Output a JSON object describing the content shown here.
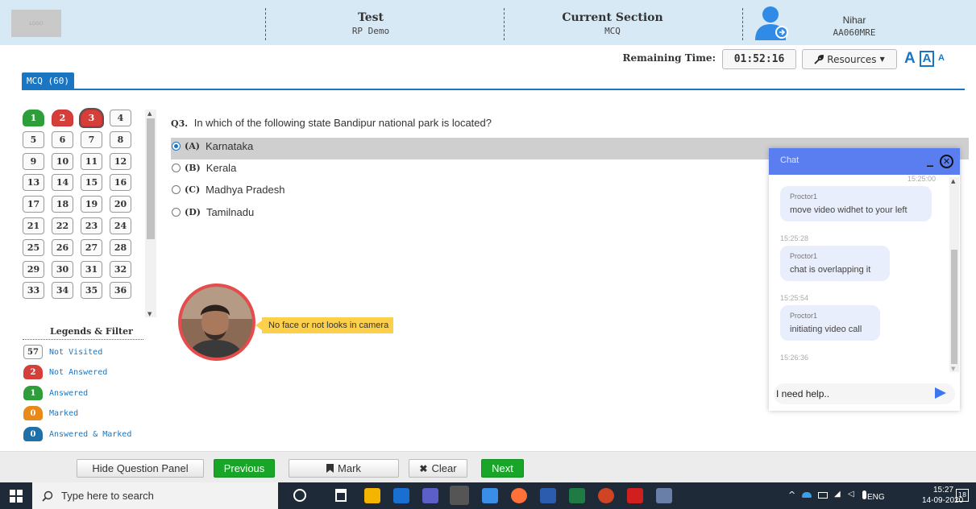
{
  "header": {
    "logo_text": "LOGO",
    "test_title": "Test",
    "test_name": "RP Demo",
    "section_title": "Current Section",
    "section_name": "MCQ",
    "user_name": "Nihar",
    "user_id": "AA060MRE"
  },
  "toolbar": {
    "remaining_label": "Remaining Time:",
    "timer": "01:52:16",
    "resources_label": "Resources",
    "font_large": "A",
    "font_medium": "A",
    "font_small": "A"
  },
  "section_tab": "MCQ (60)",
  "palette": {
    "questions": [
      {
        "n": "1",
        "state": "answered"
      },
      {
        "n": "2",
        "state": "not-answered"
      },
      {
        "n": "3",
        "state": "not-answered-current"
      },
      {
        "n": "4",
        "state": "not-visited"
      },
      {
        "n": "5",
        "state": "not-visited"
      },
      {
        "n": "6",
        "state": "not-visited"
      },
      {
        "n": "7",
        "state": "not-visited"
      },
      {
        "n": "8",
        "state": "not-visited"
      },
      {
        "n": "9",
        "state": "not-visited"
      },
      {
        "n": "10",
        "state": "not-visited"
      },
      {
        "n": "11",
        "state": "not-visited"
      },
      {
        "n": "12",
        "state": "not-visited"
      },
      {
        "n": "13",
        "state": "not-visited"
      },
      {
        "n": "14",
        "state": "not-visited"
      },
      {
        "n": "15",
        "state": "not-visited"
      },
      {
        "n": "16",
        "state": "not-visited"
      },
      {
        "n": "17",
        "state": "not-visited"
      },
      {
        "n": "18",
        "state": "not-visited"
      },
      {
        "n": "19",
        "state": "not-visited"
      },
      {
        "n": "20",
        "state": "not-visited"
      },
      {
        "n": "21",
        "state": "not-visited"
      },
      {
        "n": "22",
        "state": "not-visited"
      },
      {
        "n": "23",
        "state": "not-visited"
      },
      {
        "n": "24",
        "state": "not-visited"
      },
      {
        "n": "25",
        "state": "not-visited"
      },
      {
        "n": "26",
        "state": "not-visited"
      },
      {
        "n": "27",
        "state": "not-visited"
      },
      {
        "n": "28",
        "state": "not-visited"
      },
      {
        "n": "29",
        "state": "not-visited"
      },
      {
        "n": "30",
        "state": "not-visited"
      },
      {
        "n": "31",
        "state": "not-visited"
      },
      {
        "n": "32",
        "state": "not-visited"
      },
      {
        "n": "33",
        "state": "not-visited"
      },
      {
        "n": "34",
        "state": "not-visited"
      },
      {
        "n": "35",
        "state": "not-visited"
      },
      {
        "n": "36",
        "state": "not-visited"
      }
    ]
  },
  "legends": {
    "title": "Legends & Filter",
    "items": [
      {
        "count": "57",
        "label": "Not Visited",
        "color": "#fafafa"
      },
      {
        "count": "2",
        "label": "Not Answered",
        "color": "#d43f3a"
      },
      {
        "count": "1",
        "label": "Answered",
        "color": "#2e9e3a"
      },
      {
        "count": "0",
        "label": "Marked",
        "color": "#e8891a"
      },
      {
        "count": "0",
        "label": "Answered & Marked",
        "color": "#1f6fa8"
      }
    ]
  },
  "question": {
    "number": "Q3.",
    "text": "In which of the following state Bandipur national park is located?",
    "options": [
      {
        "label": "(A)",
        "text": "Karnataka",
        "selected": true
      },
      {
        "label": "(B)",
        "text": "Kerala",
        "selected": false
      },
      {
        "label": "(C)",
        "text": "Madhya Pradesh",
        "selected": false
      },
      {
        "label": "(D)",
        "text": "Tamilnadu",
        "selected": false
      }
    ]
  },
  "camera": {
    "warning": "No face or not looks in camera"
  },
  "chat": {
    "title": "Chat",
    "top_time": "15:25:00",
    "messages": [
      {
        "sender": "Proctor1",
        "text": "move video widhet to your left",
        "time": "15:25:28"
      },
      {
        "sender": "Proctor1",
        "text": "chat is overlapping it",
        "time": "15:25:54"
      },
      {
        "sender": "Proctor1",
        "text": "initiating video call",
        "time": "15:26:36"
      }
    ],
    "input_value": "I need help.."
  },
  "footer": {
    "hide_panel": "Hide Question Panel",
    "previous": "Previous",
    "mark": "Mark",
    "clear": "Clear",
    "next": "Next"
  },
  "taskbar": {
    "search_placeholder": "Type here to search",
    "lang": "ENG",
    "time": "15:27",
    "date": "14-09-2020",
    "notif_count": "18"
  }
}
